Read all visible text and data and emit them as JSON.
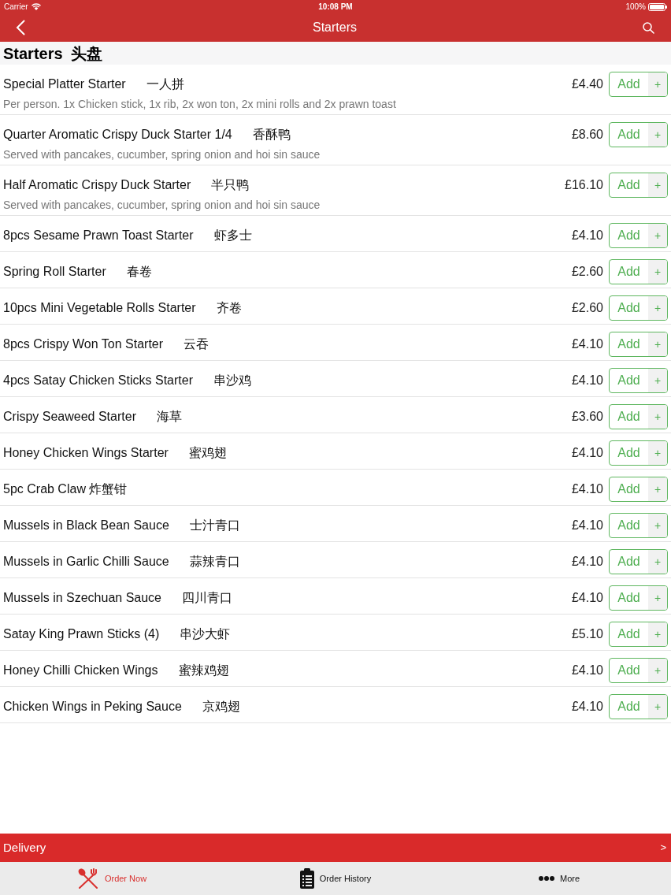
{
  "status_bar": {
    "carrier": "Carrier",
    "time": "10:08 PM",
    "battery": "100%"
  },
  "nav_bar": {
    "title": "Starters"
  },
  "section": {
    "title": "Starters",
    "title_zh": "头盘"
  },
  "items": [
    {
      "name": "Special Platter Starter",
      "name_zh": "一人拼",
      "description": "Per person. 1x Chicken stick, 1x rib, 2x won ton, 2x mini rolls and 2x prawn toast",
      "price": "£4.40",
      "button": "Add",
      "plus": "+"
    },
    {
      "name": "Quarter Aromatic Crispy Duck Starter 1/4",
      "name_zh": "香酥鸭",
      "description": "Served with pancakes, cucumber, spring onion and hoi sin sauce",
      "price": "£8.60",
      "button": "Add",
      "plus": "+"
    },
    {
      "name": "Half Aromatic Crispy Duck Starter",
      "name_zh": "半只鸭",
      "description": "Served with pancakes, cucumber, spring onion and hoi sin sauce",
      "price": "£16.10",
      "button": "Add",
      "plus": "+"
    },
    {
      "name": "8pcs Sesame Prawn Toast Starter",
      "name_zh": "虾多士",
      "price": "£4.10",
      "button": "Add",
      "plus": "+"
    },
    {
      "name": "Spring Roll Starter",
      "name_zh": "春卷",
      "price": "£2.60",
      "button": "Add",
      "plus": "+"
    },
    {
      "name": "10pcs Mini Vegetable Rolls Starter",
      "name_zh": "齐卷",
      "price": "£2.60",
      "button": "Add",
      "plus": "+"
    },
    {
      "name": "8pcs Crispy Won Ton Starter",
      "name_zh": "云吞",
      "price": "£4.10",
      "button": "Add",
      "plus": "+"
    },
    {
      "name": "4pcs Satay Chicken Sticks Starter",
      "name_zh": "串沙鸡",
      "price": "£4.10",
      "button": "Add",
      "plus": "+"
    },
    {
      "name": "Crispy Seaweed Starter",
      "name_zh": "海草",
      "price": "£3.60",
      "button": "Add",
      "plus": "+"
    },
    {
      "name": "Honey Chicken Wings Starter",
      "name_zh": "蜜鸡翅",
      "price": "£4.10",
      "button": "Add",
      "plus": "+"
    },
    {
      "name": "5pc Crab Claw 炸蟹钳",
      "price": "£4.10",
      "button": "Add",
      "plus": "+"
    },
    {
      "name": "Mussels in Black Bean Sauce",
      "name_zh": "士汁青口",
      "price": "£4.10",
      "button": "Add",
      "plus": "+"
    },
    {
      "name": "Mussels in Garlic Chilli Sauce",
      "name_zh": "蒜辣青口",
      "price": "£4.10",
      "button": "Add",
      "plus": "+"
    },
    {
      "name": "Mussels in Szechuan Sauce",
      "name_zh": "四川青口",
      "price": "£4.10",
      "button": "Add",
      "plus": "+"
    },
    {
      "name": "Satay King Prawn Sticks (4)",
      "name_zh": "串沙大虾",
      "price": "£5.10",
      "button": "Add",
      "plus": "+"
    },
    {
      "name": "Honey Chilli Chicken Wings",
      "name_zh": "蜜辣鸡翅",
      "price": "£4.10",
      "button": "Add",
      "plus": "+"
    },
    {
      "name": "Chicken Wings in Peking Sauce",
      "name_zh": "京鸡翅",
      "price": "£4.10",
      "button": "Add",
      "plus": "+"
    }
  ],
  "delivery_bar": {
    "label": "Delivery",
    "arrow": ">"
  },
  "tab_bar": [
    {
      "label": "Order Now",
      "kind": "utensils",
      "selected": true
    },
    {
      "label": "Order History",
      "kind": "clipboard",
      "selected": false
    },
    {
      "label": "More",
      "kind": "dots",
      "selected": false
    }
  ]
}
